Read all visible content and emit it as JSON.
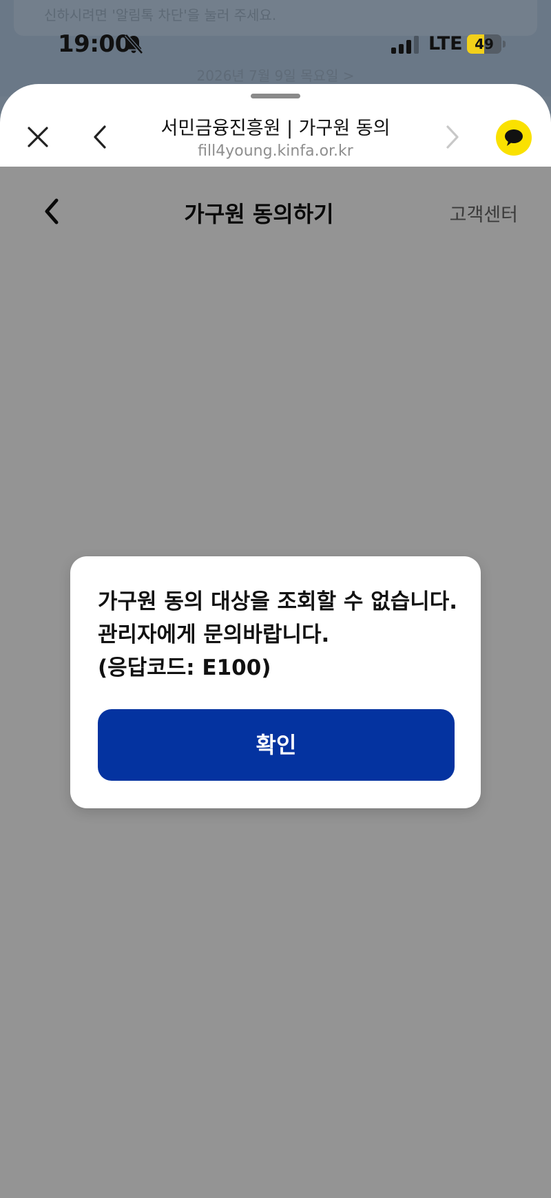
{
  "status_bar": {
    "time": "19:00",
    "network": "LTE",
    "battery": "49",
    "battery_level": 0.49
  },
  "background": {
    "banner_text": "신하시려면 '알림톡 차단'을 눌러 주세요.",
    "date_text": "2026년 7월 9일 목요일 >"
  },
  "browser": {
    "title": "서민금융진흥원 | 가구원 동의",
    "url": "fill4young.kinfa.or.kr"
  },
  "page": {
    "title": "가구원 동의하기",
    "support_label": "고객센터"
  },
  "dialog": {
    "lines": [
      "가구원 동의 대상을 조회할 수 없습니다.",
      "관리자에게 문의바랍니다.",
      "(응답코드: E100)"
    ],
    "confirm_label": "확인"
  },
  "colors": {
    "confirm_button": "#0433a0",
    "kakao_yellow": "#fae100",
    "battery_yellow": "#f2d01a"
  },
  "icons": [
    "bell-slash-icon",
    "signal-icon",
    "close-icon",
    "chevron-left-icon",
    "chevron-right-icon",
    "chat-bubble-icon"
  ]
}
